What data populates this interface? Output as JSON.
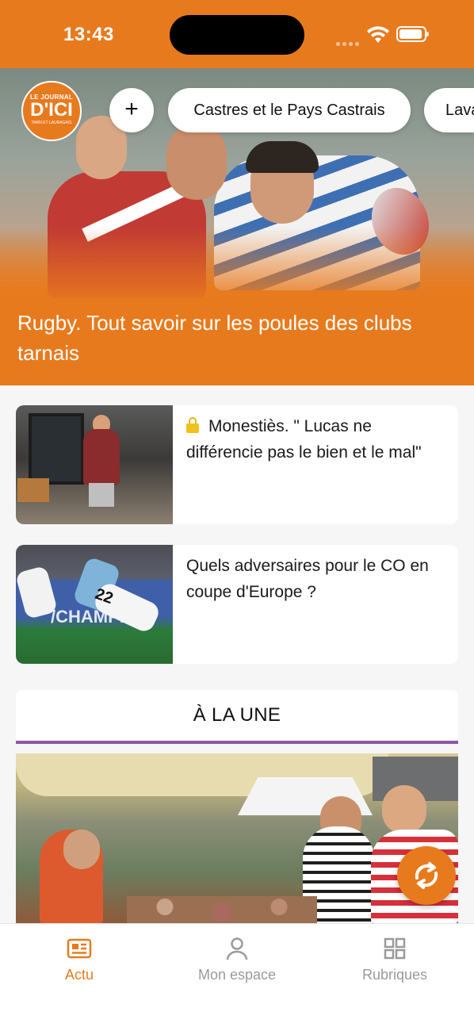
{
  "status_bar": {
    "time": "13:43"
  },
  "header": {
    "logo": {
      "line1": "LE JOURNAL",
      "line2": "D'ICI",
      "line3": "TARN ET LAURAGAIS"
    },
    "add_label": "+",
    "chips": [
      "Castres et le Pays Castrais",
      "Lava"
    ]
  },
  "hero": {
    "title": "Rugby. Tout savoir sur les poules des clubs tarnais"
  },
  "articles": [
    {
      "title": "Monestiès. \" Lucas ne différencie pas le bien et le mal\"",
      "locked": true
    },
    {
      "title": "Quels adversaires pour le CO en coupe d'Europe ?",
      "locked": false
    }
  ],
  "thumb2_text": {
    "number": "22",
    "brand": "/CHAMPION"
  },
  "section": {
    "title": "À LA UNE"
  },
  "tabbar": {
    "tabs": [
      {
        "label": "Actu",
        "icon": "newspaper-icon",
        "active": true
      },
      {
        "label": "Mon espace",
        "icon": "person-icon",
        "active": false
      },
      {
        "label": "Rubriques",
        "icon": "grid-icon",
        "active": false
      }
    ]
  },
  "colors": {
    "accent": "#e87a1e",
    "section_underline": "#8e56a3",
    "lock": "#f2c21b"
  }
}
